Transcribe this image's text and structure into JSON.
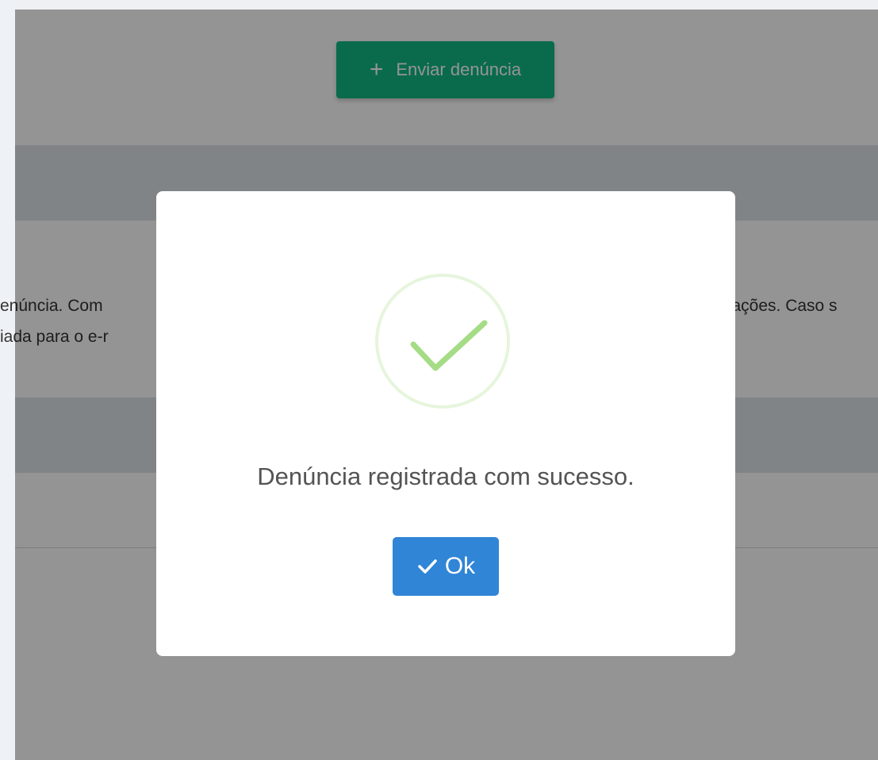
{
  "page": {
    "send_button": {
      "icon": "plus-icon",
      "label": "Enviar denúncia"
    },
    "body_text": {
      "line1_left": "enúncia. Com",
      "line2_left": "iada para o e-r",
      "line1_right": "mações. Caso s"
    }
  },
  "dialog": {
    "icon": "success-check-icon",
    "message": "Denúncia registrada com sucesso.",
    "ok_button": {
      "icon": "check-icon",
      "label": "Ok"
    }
  },
  "colors": {
    "send_button": "#10b981",
    "ok_button": "#3085d6",
    "success_icon": "#a5dc86",
    "overlay": "rgba(0,0,0,0.42)"
  }
}
